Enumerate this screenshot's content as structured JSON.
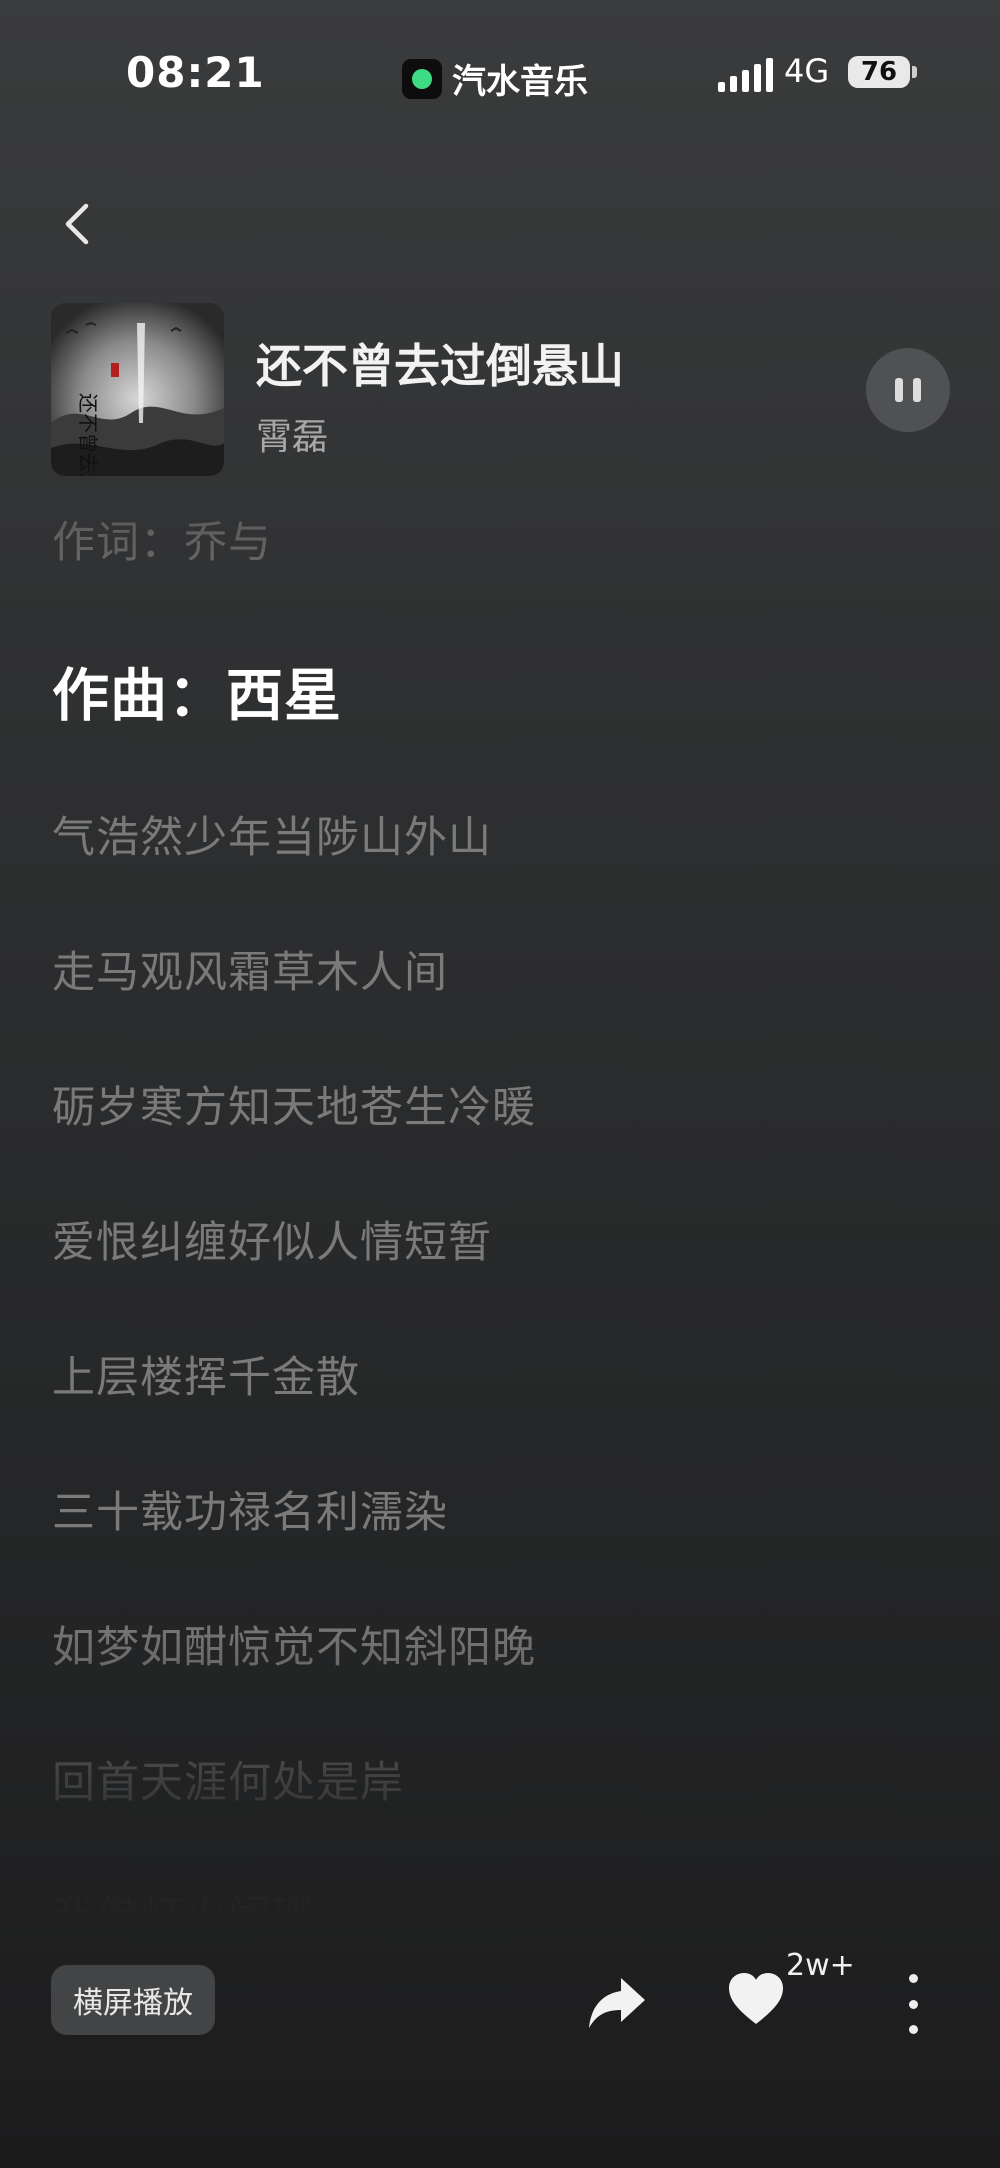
{
  "status_bar": {
    "time": "08:21",
    "app_name": "汽水音乐",
    "network": "4G",
    "battery": "76"
  },
  "song": {
    "title": "还不曾去过倒悬山",
    "artist": "霄磊",
    "cover_art_text": "还不曾去过倒悬山"
  },
  "lyrics": [
    {
      "text": "作词：乔与",
      "current": false
    },
    {
      "text": "作曲：西星",
      "current": true
    },
    {
      "text": "气浩然少年当陟山外山",
      "current": false
    },
    {
      "text": "走马观风霜草木人间",
      "current": false
    },
    {
      "text": "砺岁寒方知天地苍生冷暖",
      "current": false
    },
    {
      "text": "爱恨纠缠好似人情短暂",
      "current": false
    },
    {
      "text": "上层楼挥千金散",
      "current": false
    },
    {
      "text": "三十载功禄名利濡染",
      "current": false
    },
    {
      "text": "如梦如酣惊觉不知斜阳晚",
      "current": false
    },
    {
      "text": "回首天涯何处是岸",
      "current": false
    },
    {
      "text": "我借灯火阑珊",
      "current": false
    }
  ],
  "actions": {
    "landscape_label": "横屏播放",
    "like_count": "2w+"
  },
  "colors": {
    "background_top": "#3a3b3c",
    "background_bottom": "#1c1c1d",
    "lyric_inactive": "#7a7a7a",
    "lyric_active": "#ffffff",
    "app_logo_accent": "#3ddc84"
  },
  "icons": {
    "back": "chevron-left-icon",
    "pause": "pause-icon",
    "share": "share-arrow-icon",
    "like": "heart-icon",
    "more": "more-vertical-icon"
  }
}
